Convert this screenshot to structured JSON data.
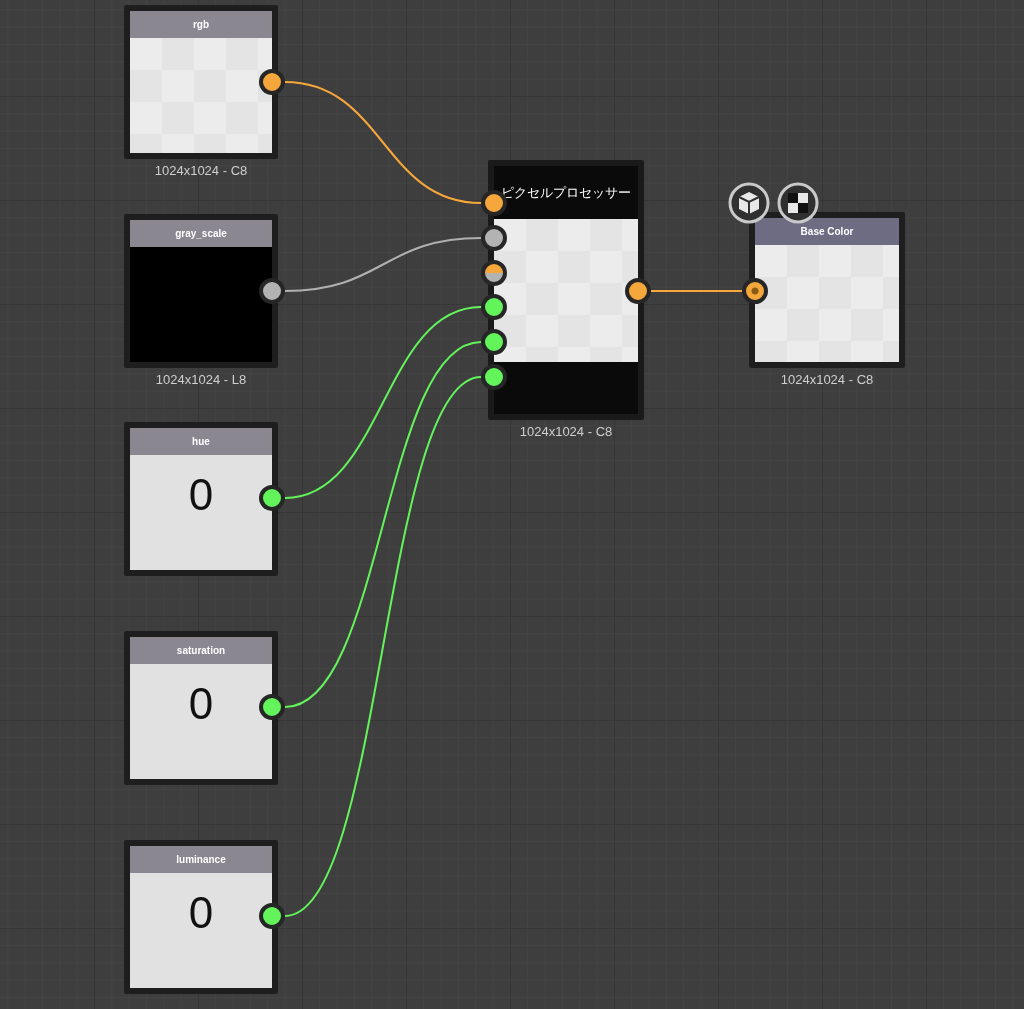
{
  "nodes": [
    {
      "kind": "texture",
      "title": "rgb",
      "preview": {
        "kind": "checker"
      },
      "footer": "1024x1024 - C8",
      "outputs": [
        {
          "kind": "color"
        }
      ]
    },
    {
      "kind": "texture",
      "title": "gray_scale",
      "preview": {
        "kind": "black"
      },
      "footer": "1024x1024 - L8",
      "outputs": [
        {
          "kind": "gray"
        }
      ]
    },
    {
      "kind": "value",
      "title": "hue",
      "value": "0",
      "outputs": [
        {
          "kind": "scalar"
        }
      ]
    },
    {
      "kind": "value",
      "title": "saturation",
      "value": "0",
      "outputs": [
        {
          "kind": "scalar"
        }
      ]
    },
    {
      "kind": "value",
      "title": "luminance",
      "value": "0",
      "outputs": [
        {
          "kind": "scalar"
        }
      ]
    },
    {
      "kind": "processor",
      "title": "ピクセルプロセッサー",
      "preview": {
        "kind": "checker"
      },
      "footer": "1024x1024 - C8",
      "inputs": [
        {
          "kind": "color",
          "linked": true
        },
        {
          "kind": "gray",
          "linked": true
        },
        {
          "kind": "mixed",
          "linked": false
        },
        {
          "kind": "scalar",
          "linked": true
        },
        {
          "kind": "scalar",
          "linked": true
        },
        {
          "kind": "scalar",
          "linked": true
        }
      ],
      "outputs": [
        {
          "kind": "color"
        }
      ]
    },
    {
      "kind": "output",
      "title": "Base Color",
      "preview": {
        "kind": "checker"
      },
      "footer": "1024x1024 - C8",
      "inputs": [
        {
          "kind": "target",
          "linked": true
        }
      ]
    }
  ]
}
